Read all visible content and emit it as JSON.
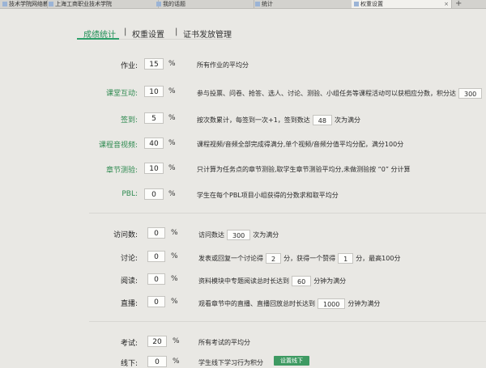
{
  "browser": {
    "tabs": [
      {
        "label": "技术学院网络教..."
      },
      {
        "label": "上海工商职业技术学院"
      },
      {
        "label": "我的话题"
      },
      {
        "label": "统计"
      },
      {
        "label": "权重设置"
      }
    ],
    "new_tab": "+",
    "close": "×"
  },
  "nav": {
    "tab_stats": "成绩统计",
    "sep1": "|",
    "tab_weights": "权重设置",
    "sep2": "|",
    "tab_cert": "证书发放管理"
  },
  "percent_sign": "%",
  "weights_group1": [
    {
      "label": "作业:",
      "value": "15",
      "desc": "所有作业的平均分"
    },
    {
      "label": "课堂互动:",
      "value": "10",
      "desc": "参与投票、问卷、抢答、选人、讨论、测验、小组任务等课程活动可以获相应分数，积分达",
      "desc_box": "300"
    },
    {
      "label": "签到:",
      "value": "5",
      "desc_pre": "按次数累计，每签到一次+1，签到数达",
      "desc_box": "48",
      "desc_post": "次为满分"
    },
    {
      "label": "课程音视频:",
      "value": "40",
      "desc": "课程视频/音频全部完成得满分,单个视频/音频分值平均分配，满分100分"
    },
    {
      "label": "章节测验:",
      "value": "10",
      "desc": "只计算为任务点的章节测验,取学生章节测验平均分,未做测验按 “0” 分计算"
    },
    {
      "label": "PBL:",
      "value": "0",
      "desc": "学生在每个PBL项目小组获得的分数求和取平均分"
    }
  ],
  "weights_group2": [
    {
      "label": "访问数:",
      "value": "0",
      "desc_pre": "访问数达",
      "desc_box": "300",
      "desc_post": "次为满分"
    },
    {
      "label": "讨论:",
      "value": "0",
      "desc_pre": "发表或回复一个讨论得",
      "desc_box": "2",
      "desc_mid": "分，获得一个赞得",
      "desc_box2": "1",
      "desc_post": "分，最高100分"
    },
    {
      "label": "阅读:",
      "value": "0",
      "desc_pre": "资料模块中专题阅读总时长达到",
      "desc_box": "60",
      "desc_post": "分钟为满分"
    },
    {
      "label": "直播:",
      "value": "0",
      "desc_pre": "观看章节中的直播、直播回放总时长达到",
      "desc_box": "1000",
      "desc_post": "分钟为满分"
    }
  ],
  "weights_group3": [
    {
      "label": "考试:",
      "value": "20",
      "desc": "所有考试的平均分"
    }
  ],
  "partial_row": {
    "label": "线下:",
    "value": "0",
    "desc": "学生线下学习行为积分",
    "button": "设置线下"
  }
}
